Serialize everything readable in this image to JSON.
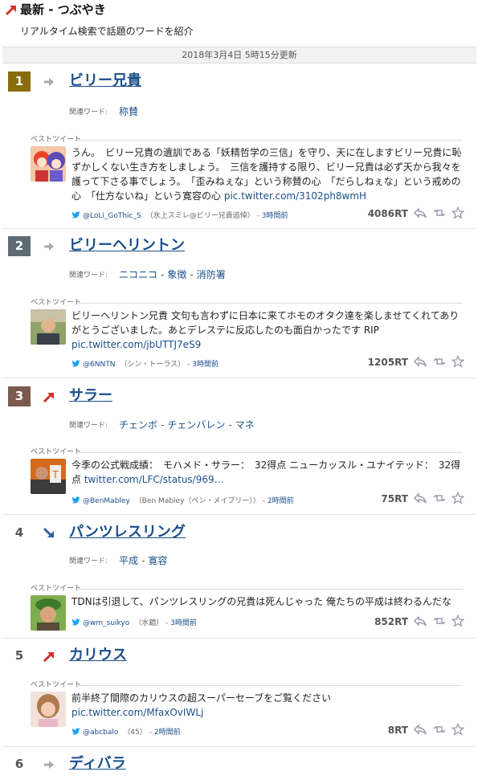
{
  "header": {
    "title": "最新 - つぶやき",
    "subtitle": "リアルタイム検索で話題のワードを紹介",
    "updated": "2018年3月4日 5時15分更新"
  },
  "labels": {
    "related": "関連ワード:",
    "best_tweet": "ベストツイート"
  },
  "colors": {
    "rank1": "#8a6d0b",
    "rank2": "#5f6b73",
    "rank3": "#7a5a4e",
    "trend_up": "#d0312d",
    "trend_same": "#aaaaaa",
    "trend_down": "#2f5fa8",
    "link": "#1a4f8b"
  },
  "entries": [
    {
      "rank": "1",
      "trend": "same",
      "word": "ビリー兄貴",
      "related": [
        "称賛"
      ],
      "tweet": {
        "text": "うん。　ビリー兄貴の遺訓である「妖精哲学の三信」を守り、天に在しますビリー兄貴に恥ずかしくない生き方をしましょう。　三信を護持する限り、ビリー兄貴は必ず天から我々を護って下さる事でしょう。　「歪みねぇな」という称賛の心　「だらしねぇな」という戒めの心　「仕方ないね」という寛容の心 ",
        "link": "pic.twitter.com/3102ph8wmH",
        "user": "@LoLi_GoThic_S",
        "display": "（氷上スミレ@ビリー兄貴追悼）",
        "time": "3時間前",
        "rt": "4086RT"
      }
    },
    {
      "rank": "2",
      "trend": "same",
      "word": "ビリーヘリントン",
      "related": [
        "ニコニコ",
        "象徴",
        "消防署"
      ],
      "tweet": {
        "text": "ビリーヘリントン兄貴 文句も言わずに日本に来てホモのオタク達を楽しませてくれてありがとうございました。あとデレステに反応したのも面白かったです RIP ",
        "link": "pic.twitter.com/jbUTTJ7eS9",
        "user": "@6NNTN",
        "display": "（シン・トーラス）",
        "time": "3時間前",
        "rt": "1205RT"
      }
    },
    {
      "rank": "3",
      "trend": "up",
      "word": "サラー",
      "related": [
        "チェンボ",
        "チェンバレン",
        "マネ"
      ],
      "tweet": {
        "text": "今季の公式戦成績：　モハメド・サラー：　32得点 ニューカッスル・ユナイテッド：　32得点 ",
        "link": "twitter.com/LFC/status/969…",
        "user": "@BenMabley",
        "display": "（Ben Mabley（ベン・メイブリー））",
        "time": "2時間前",
        "rt": "75RT"
      }
    },
    {
      "rank": "4",
      "trend": "down",
      "word": "パンツレスリング",
      "related": [
        "平成",
        "寛容"
      ],
      "tweet": {
        "text": "TDNは引退して、パンツレスリングの兄貴は死んじゃった 俺たちの平成は終わるんだな",
        "link": "",
        "user": "@wm_suikyo",
        "display": "（水鏡）",
        "time": "3時間前",
        "rt": "852RT"
      }
    },
    {
      "rank": "5",
      "trend": "up",
      "word": "カリウス",
      "related": [],
      "tweet": {
        "text": "前半終了間際のカリウスの超スーパーセーブをご覧ください ",
        "link": "pic.twitter.com/MfaxOvIWLj",
        "user": "@abcbalo",
        "display": "（45）",
        "time": "2時間前",
        "rt": "8RT"
      }
    },
    {
      "rank": "6",
      "trend": "same",
      "word": "ディバラ",
      "related": [],
      "tweet": null
    }
  ]
}
